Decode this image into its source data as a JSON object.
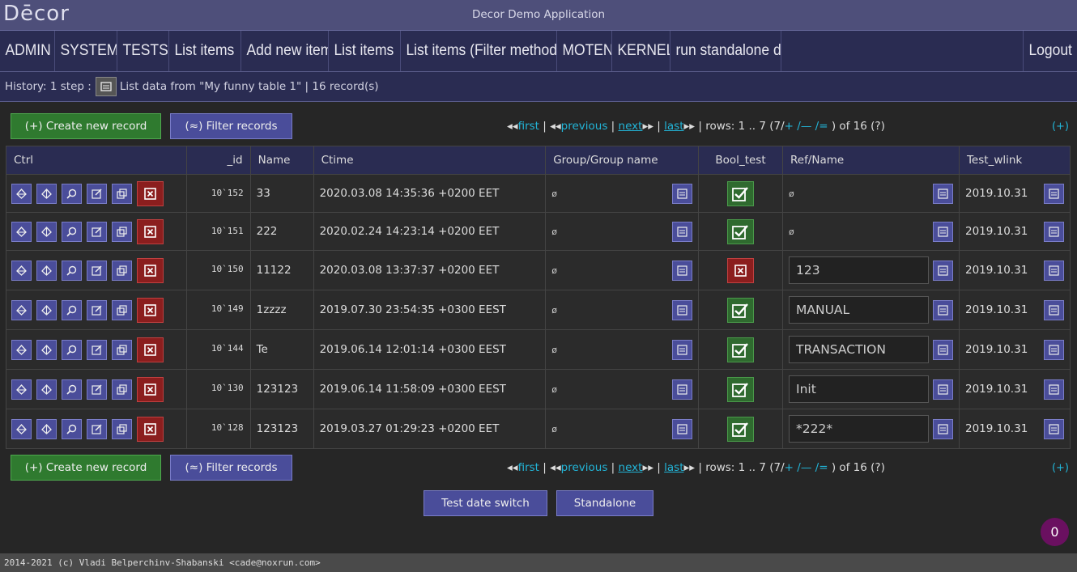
{
  "app": {
    "logo": "Dēcor",
    "title": "Decor Demo Application"
  },
  "menu": {
    "items": [
      "ADMIN",
      "SYSTEM",
      "TESTS",
      "List items",
      "Add new item",
      "List items",
      "List items (Filter method)",
      "MOTEN",
      "KERNEL",
      "run standalone do"
    ],
    "logout": "Logout"
  },
  "history": {
    "prefix": "History: 1 step :",
    "text": "List data from \"My funny table 1\" | 16 record(s)"
  },
  "toolbar": {
    "create_label": "(+) Create new record",
    "filter_label": "(≈) Filter records",
    "expand_label": "(+)"
  },
  "pager": {
    "first": "first",
    "previous": "previous",
    "next": "next",
    "last": "last",
    "rows_prefix": "| rows: 1 .. 7 (7/",
    "plus": "+",
    "minus": "/—",
    "eq": "/=",
    "rows_suffix": ") of 16 (?)"
  },
  "table": {
    "headers": [
      "Ctrl",
      "_id",
      "Name",
      "Ctime",
      "Group/Group name",
      "Bool_test",
      "Ref/Name",
      "Test_wlink"
    ],
    "rows": [
      {
        "id": "10`152",
        "name": "33",
        "ctime": "2020.03.08 14:35:36 +0200 EET",
        "group": "ø",
        "bool": true,
        "ref": "ø",
        "ref_input": false,
        "wlink": "2019.10.31"
      },
      {
        "id": "10`151",
        "name": "222",
        "ctime": "2020.02.24 14:23:14 +0200 EET",
        "group": "ø",
        "bool": true,
        "ref": "ø",
        "ref_input": false,
        "wlink": "2019.10.31"
      },
      {
        "id": "10`150",
        "name": "11122",
        "ctime": "2020.03.08 13:37:37 +0200 EET",
        "group": "ø",
        "bool": false,
        "ref": "123",
        "ref_input": true,
        "wlink": "2019.10.31"
      },
      {
        "id": "10`149",
        "name": "1zzzz",
        "ctime": "2019.07.30 23:54:35 +0300 EEST",
        "group": "ø",
        "bool": true,
        "ref": "MANUAL",
        "ref_input": true,
        "wlink": "2019.10.31"
      },
      {
        "id": "10`144",
        "name": "Te",
        "ctime": "2019.06.14 12:01:14 +0300 EEST",
        "group": "ø",
        "bool": true,
        "ref": "TRANSACTION",
        "ref_input": true,
        "wlink": "2019.10.31"
      },
      {
        "id": "10`130",
        "name": "123123",
        "ctime": "2019.06.14 11:58:09 +0300 EEST",
        "group": "ø",
        "bool": true,
        "ref": "Init",
        "ref_input": true,
        "wlink": "2019.10.31"
      },
      {
        "id": "10`128",
        "name": "123123",
        "ctime": "2019.03.27 01:29:23 +0200 EET",
        "group": "ø",
        "bool": true,
        "ref": "*222*",
        "ref_input": true,
        "wlink": "2019.10.31"
      }
    ]
  },
  "bottom": {
    "date_switch": "Test date switch",
    "standalone": "Standalone"
  },
  "badge": "0",
  "footer": "2014-2021 (c) Vladi Belperchinv-Shabanski <cade@noxrun.com>",
  "colors": {
    "accent": "#22b5d8",
    "create": "#2f7a2f",
    "filter": "#4a4d9a",
    "delete": "#8b1e1e",
    "header": "#2a2c52"
  }
}
